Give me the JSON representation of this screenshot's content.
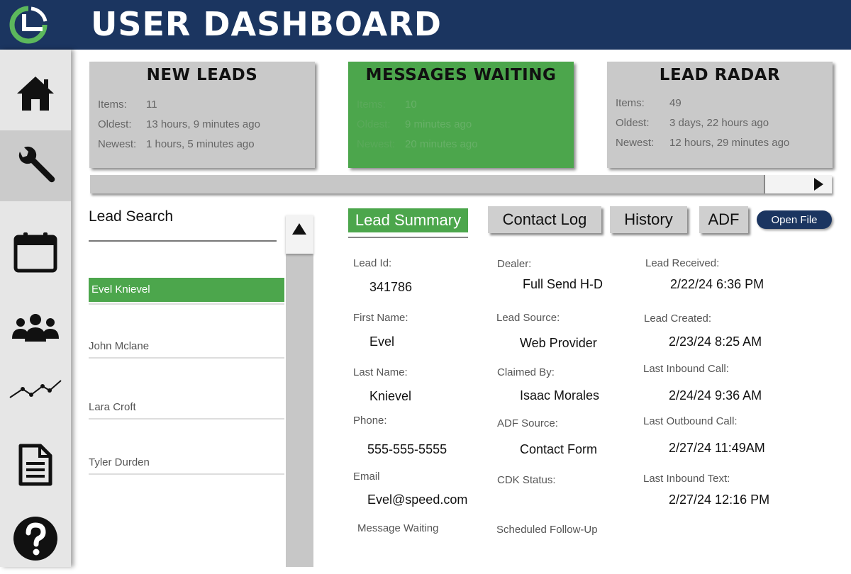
{
  "header": {
    "title": "USER DASHBOARD",
    "logo_icon": "clock-pie-logo-icon"
  },
  "sidebar": {
    "items": [
      {
        "id": "home",
        "icon": "home-icon",
        "active": false
      },
      {
        "id": "tools",
        "icon": "wrench-icon",
        "active": true
      },
      {
        "id": "calendar",
        "icon": "calendar-icon",
        "active": false
      },
      {
        "id": "users",
        "icon": "users-icon",
        "active": false
      },
      {
        "id": "analytics",
        "icon": "line-chart-icon",
        "active": false
      },
      {
        "id": "documents",
        "icon": "document-icon",
        "active": false
      },
      {
        "id": "help",
        "icon": "help-icon",
        "active": false
      }
    ]
  },
  "cards": [
    {
      "title": "NEW LEADS",
      "rows": [
        {
          "label": "Items:",
          "value": "11"
        },
        {
          "label": "Oldest:",
          "value": "13 hours, 9 minutes ago"
        },
        {
          "label": "Newest:",
          "value": "1 hours, 5 minutes ago"
        }
      ]
    },
    {
      "title": "MESSAGES WAITING",
      "rows": [
        {
          "label": "Items:",
          "value": "10"
        },
        {
          "label": "Oldest:",
          "value": "9 minutes ago"
        },
        {
          "label": "Newest:",
          "value": "20 minutes ago"
        }
      ]
    },
    {
      "title": "LEAD RADAR",
      "rows": [
        {
          "label": "Items:",
          "value": "49"
        },
        {
          "label": "Oldest:",
          "value": "3 days, 22 hours ago"
        },
        {
          "label": "Newest:",
          "value": "12 hours, 29 minutes ago"
        }
      ]
    }
  ],
  "lead_search": {
    "label": "Lead Search",
    "leads": [
      "Evel Knievel",
      "John Mclane",
      "Lara Croft",
      "Tyler Durden"
    ],
    "selected": "Evel Knievel"
  },
  "tabs": {
    "lead_summary": "Lead Summary",
    "contact_log": "Contact Log",
    "history": "History",
    "adf": "ADF",
    "open_file": "Open File"
  },
  "lead": {
    "col1": [
      {
        "label": "Lead Id:",
        "value": "341786"
      },
      {
        "label": "First Name:",
        "value": "Evel"
      },
      {
        "label": "Last Name:",
        "value": "Knievel"
      },
      {
        "label": "Phone:",
        "value": "555-555-5555"
      },
      {
        "label": "Email",
        "value": "Evel@speed.com"
      },
      {
        "label": "Message Waiting",
        "value": ""
      }
    ],
    "col2": [
      {
        "label": "Dealer:",
        "value": "Full Send H-D"
      },
      {
        "label": "Lead Source:",
        "value": "Web Provider"
      },
      {
        "label": "Claimed By:",
        "value": "Isaac Morales"
      },
      {
        "label": "ADF Source:",
        "value": "Contact Form"
      },
      {
        "label": "CDK Status:",
        "value": ""
      },
      {
        "label": "Scheduled Follow-Up",
        "value": ""
      }
    ],
    "col3": [
      {
        "label": "Lead Received:",
        "value": "2/22/24 6:36 PM"
      },
      {
        "label": "Lead Created:",
        "value": "2/23/24 8:25 AM"
      },
      {
        "label": "Last Inbound Call:",
        "value": "2/24/24 9:36 AM"
      },
      {
        "label": "Last Outbound Call:",
        "value": "2/27/24 11:49AM"
      },
      {
        "label": "Last Inbound Text:",
        "value": "2/27/24 12:16 PM"
      }
    ]
  },
  "colors": {
    "header_bg": "#1b3560",
    "accent_green": "#4ca64c",
    "card_gray": "#c9c9c9",
    "logo_green": "#5cb85c"
  }
}
